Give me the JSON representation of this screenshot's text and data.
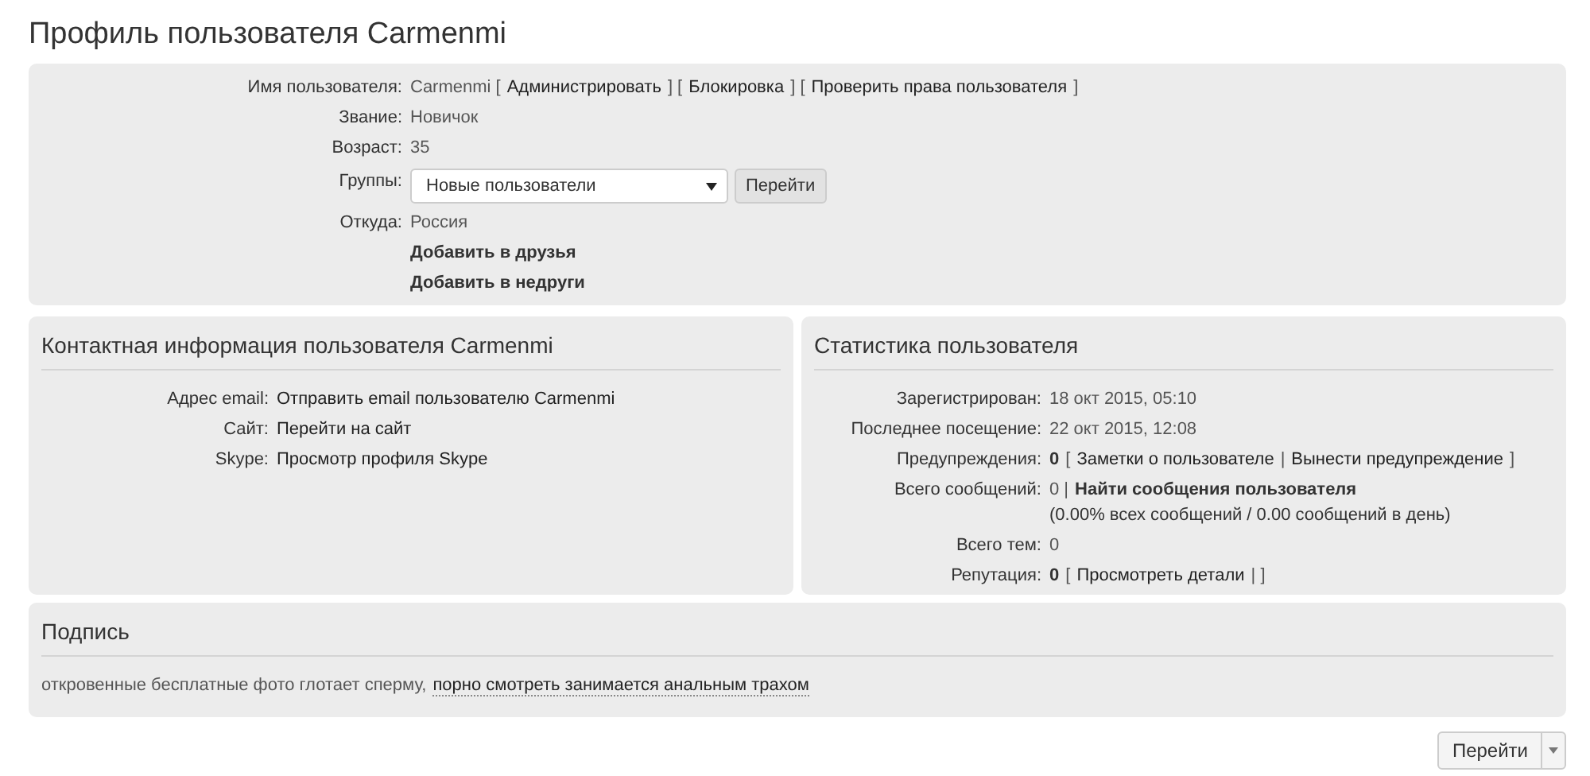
{
  "page_title": "Профиль пользователя Carmenmi",
  "profile": {
    "fields": [
      {
        "kind": "text",
        "label": "Имя пользователя:",
        "segments": [
          {
            "kind": "plain",
            "text": "Carmenmi ["
          },
          {
            "kind": "link",
            "text": "Администрировать"
          },
          {
            "kind": "plain",
            "text": "] ["
          },
          {
            "kind": "link",
            "text": "Блокировка"
          },
          {
            "kind": "plain",
            "text": "] ["
          },
          {
            "kind": "link",
            "text": "Проверить права пользователя"
          },
          {
            "kind": "plain",
            "text": "]"
          }
        ]
      },
      {
        "kind": "text",
        "label": "Звание:",
        "segments": [
          {
            "kind": "plain",
            "text": "Новичок"
          }
        ]
      },
      {
        "kind": "text",
        "label": "Возраст:",
        "segments": [
          {
            "kind": "plain",
            "text": "35"
          }
        ]
      },
      {
        "kind": "select",
        "label": "Группы:",
        "value": "Новые пользователи",
        "button": "Перейти"
      },
      {
        "kind": "text",
        "label": "Откуда:",
        "segments": [
          {
            "kind": "plain",
            "text": "Россия"
          }
        ]
      },
      {
        "kind": "action",
        "text": "Добавить в друзья"
      },
      {
        "kind": "action",
        "text": "Добавить в недруги"
      }
    ]
  },
  "contact": {
    "title": "Контактная информация пользователя Carmenmi",
    "fields": [
      {
        "label": "Адрес email:",
        "segments": [
          {
            "kind": "link",
            "text": "Отправить email пользователю Carmenmi"
          }
        ]
      },
      {
        "label": "Сайт:",
        "segments": [
          {
            "kind": "link",
            "text": "Перейти на сайт"
          }
        ]
      },
      {
        "label": "Skype:",
        "segments": [
          {
            "kind": "link",
            "text": "Просмотр профиля Skype"
          }
        ]
      }
    ]
  },
  "stats": {
    "title": "Статистика пользователя",
    "fields": [
      {
        "label": "Зарегистрирован:",
        "segments": [
          {
            "kind": "plain",
            "text": "18 окт 2015, 05:10"
          }
        ]
      },
      {
        "label": "Последнее посещение:",
        "segments": [
          {
            "kind": "plain",
            "text": "22 окт 2015, 12:08"
          }
        ]
      },
      {
        "label": "Предупреждения:",
        "segments": [
          {
            "kind": "bold",
            "text": "0"
          },
          {
            "kind": "plain",
            "text": "["
          },
          {
            "kind": "link",
            "text": "Заметки о пользователе"
          },
          {
            "kind": "plain",
            "text": "|"
          },
          {
            "kind": "link",
            "text": "Вынести предупреждение"
          },
          {
            "kind": "plain",
            "text": "]"
          }
        ]
      },
      {
        "label": "Всего сообщений:",
        "segments": [
          {
            "kind": "plain",
            "text": "0 |"
          },
          {
            "kind": "boldlink",
            "text": "Найти сообщения пользователя"
          }
        ],
        "note": "(0.00% всех сообщений / 0.00 сообщений в день)"
      },
      {
        "label": "Всего тем:",
        "segments": [
          {
            "kind": "plain",
            "text": "0"
          }
        ]
      },
      {
        "label": "Репутация:",
        "segments": [
          {
            "kind": "bold",
            "text": "0"
          },
          {
            "kind": "plain",
            "text": "["
          },
          {
            "kind": "link",
            "text": "Просмотреть детали"
          },
          {
            "kind": "plain",
            "text": "| ]"
          }
        ]
      }
    ]
  },
  "signature": {
    "title": "Подпись",
    "segments": [
      {
        "kind": "plain",
        "text": "откровенные бесплатные фото глотает сперму,"
      },
      {
        "kind": "link",
        "text": "порно смотреть занимается анальным трахом"
      }
    ]
  },
  "jump_button": {
    "label": "Перейти"
  }
}
